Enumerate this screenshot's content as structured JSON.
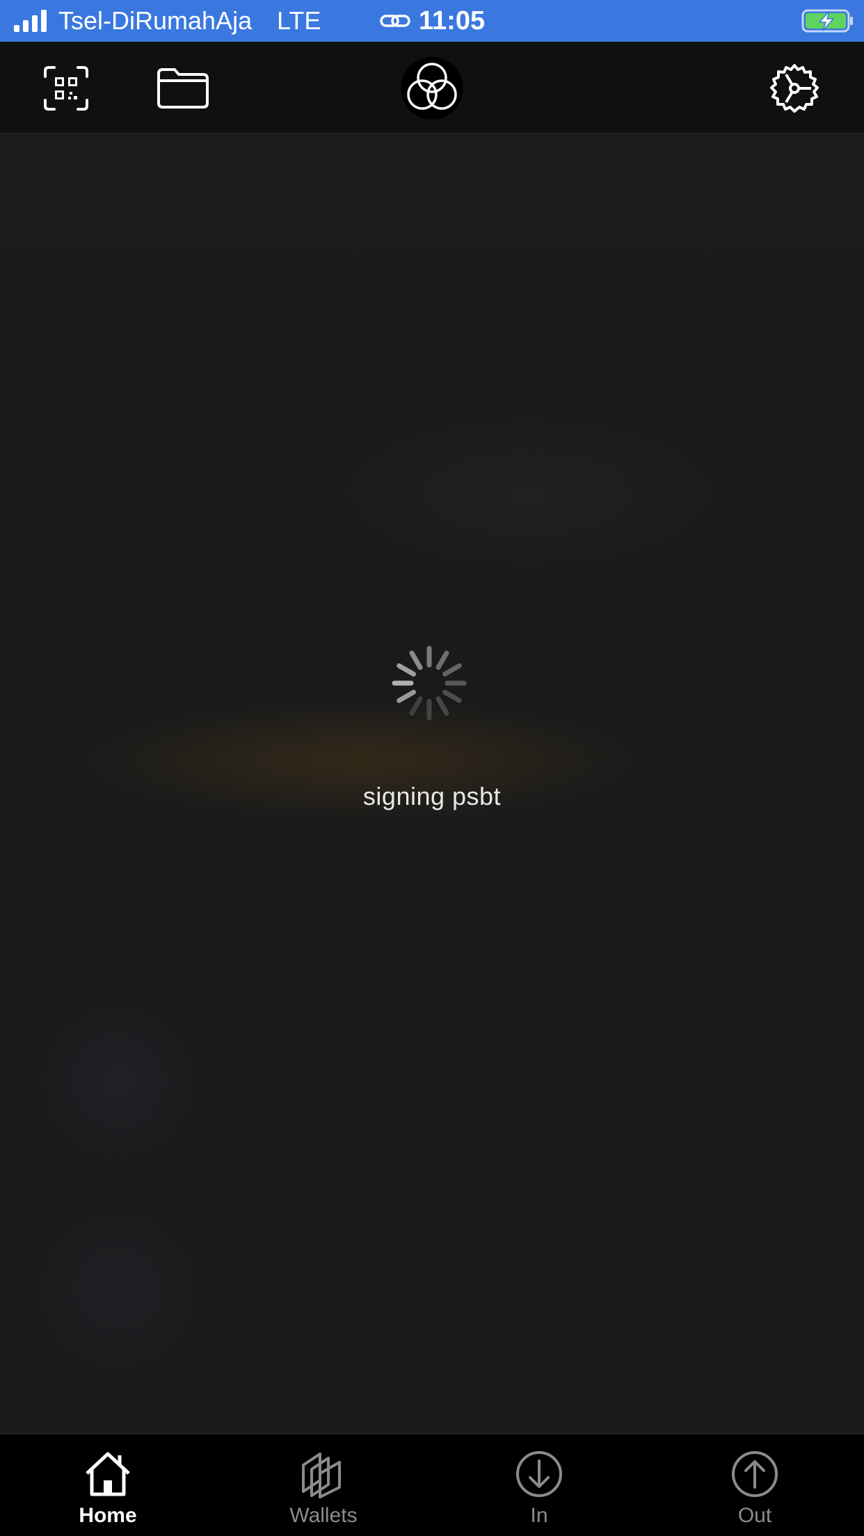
{
  "status_bar": {
    "carrier": "Tsel-DiRumahAja",
    "network": "LTE",
    "time": "11:05",
    "signal_bars": 4,
    "battery_charging": true,
    "background_color": "#3a78e0"
  },
  "toolbar": {
    "qr_icon": "qr-code-scan-icon",
    "folder_icon": "folder-icon",
    "logo_icon": "three-circles-logo",
    "settings_icon": "gear-icon"
  },
  "main": {
    "loading_text": "signing psbt"
  },
  "tabs": [
    {
      "label": "Home",
      "icon": "home-icon",
      "active": true
    },
    {
      "label": "Wallets",
      "icon": "wallets-icon",
      "active": false
    },
    {
      "label": "In",
      "icon": "arrow-down-circle-icon",
      "active": false
    },
    {
      "label": "Out",
      "icon": "arrow-up-circle-icon",
      "active": false
    }
  ],
  "colors": {
    "background": "#1b1c1d",
    "toolbar": "#0f1012",
    "tabbar": "#000000",
    "tab_active": "#ffffff",
    "tab_inactive": "#8a8b8d"
  }
}
